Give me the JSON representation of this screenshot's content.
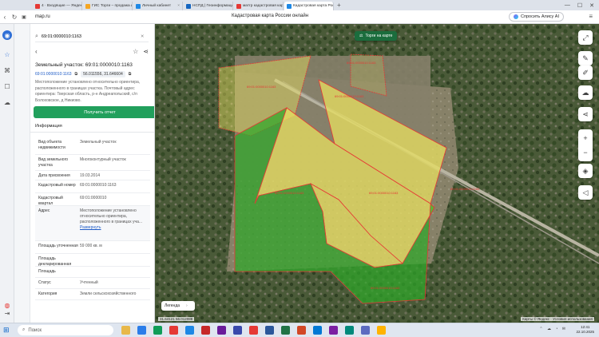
{
  "browser": {
    "tabs": [
      {
        "title": "4 · Входящие — Яндекс Почта",
        "color": "#e53935",
        "active": false
      },
      {
        "title": "ГИС Торги – продажа имущества",
        "color": "#f5a623",
        "active": false
      },
      {
        "title": "Личный кабинет",
        "color": "#1e88e5",
        "active": false
      },
      {
        "title": "НСПД | Геоинформационная…",
        "color": "#1565c0",
        "active": false
      },
      {
        "title": "матгр кадастровая карта",
        "color": "#e53935",
        "active": false
      },
      {
        "title": "Кадастровая карта России",
        "color": "#1e88e5",
        "active": true
      }
    ],
    "new_tab": "+",
    "url": "map.ru",
    "page_title": "Кадастровая карта России онлайн",
    "alice_label": "Спросить Алису AI",
    "menu": "≡ — ☐ ✕"
  },
  "panel": {
    "search_value": "69:01:0000010:1163",
    "zone_title": "Земельный участок: 69:01:0000010:1163",
    "cad_link": "69:01:0000010:1163",
    "coord_tag": "56.011556, 31.646604",
    "address": "Местоположение установлено относительно ориентира, расположенного в границах участка. Почтовый адрес ориентира: Тверская область, р-н Андреапольский, с/п Болоховское, д Никиово.",
    "get_report": "Получить отчет",
    "info_tab": "Информация",
    "rows": [
      {
        "k": "Вид объекта недвижимости",
        "v": "Земельный участок"
      },
      {
        "k": "Вид земельного участка",
        "v": "Многоконтурный участок"
      },
      {
        "k": "Дата присвоения",
        "v": "19.03.2014"
      },
      {
        "k": "Кадастровый номер",
        "v": "69:01:0000010:1163"
      },
      {
        "k": "Кадастровый квартал",
        "v": "69:01:0000010"
      },
      {
        "k": "Адрес",
        "v": "Местоположение установлено относительно ориентира, расположенного в границах уча...",
        "link": "Развернуть"
      },
      {
        "k": "Площадь уточненная",
        "v": "59 000 кв. м"
      },
      {
        "k": "Площадь декларированная",
        "v": ""
      },
      {
        "k": "Площадь",
        "v": ""
      },
      {
        "k": "Статус",
        "v": "Учтенный"
      },
      {
        "k": "Категория",
        "v": "Земли сельскохозяйственного"
      }
    ]
  },
  "map": {
    "torgi_button": "Торги на карте",
    "legend": "Легенда",
    "coords_readout": "31.64121   56.012088",
    "attribution": "Карты © Яндекс · Условия использования",
    "parcel_labels": [
      "69:01:0000010:1163",
      "69:01:0000010:1163",
      "69:01:0000010:1163",
      "69:01:0000010:1163",
      "69:01:0000010:1163",
      "69:01:0000010:1163",
      "69:01:0000010:1163"
    ],
    "colors": {
      "yellow": "#e8e060",
      "green": "#2fa82a",
      "border": "#e53935"
    }
  },
  "taskbar": {
    "search_placeholder": "Поиск",
    "time": "12:41",
    "date": "22.10.2025"
  }
}
